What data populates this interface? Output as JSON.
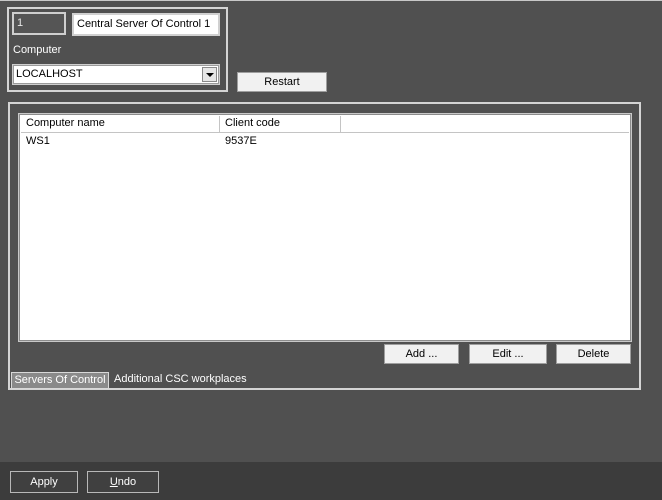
{
  "server": {
    "id_value": "1",
    "name_value": "Central Server Of Control 1",
    "computer_label": "Computer",
    "computer_selected": "LOCALHOST",
    "restart_label": "Restart"
  },
  "workplaces": {
    "columns": [
      "Computer name",
      "Client code"
    ],
    "rows": [
      {
        "computer_name": "WS1",
        "client_code": "9537E"
      }
    ],
    "add_label": "Add ...",
    "edit_label": "Edit ...",
    "delete_label": "Delete"
  },
  "tabs": [
    {
      "label": "Servers Of Control",
      "active": true
    },
    {
      "label": "Additional CSC workplaces",
      "active": false
    }
  ],
  "footer": {
    "apply_label": "Apply",
    "undo_label": "Undo"
  },
  "colors": {
    "background": "#505050",
    "footer_background": "#3c3c3c",
    "active_tab": "#8a8a8a"
  },
  "icons": {
    "dropdown": "chevron-down-icon"
  }
}
